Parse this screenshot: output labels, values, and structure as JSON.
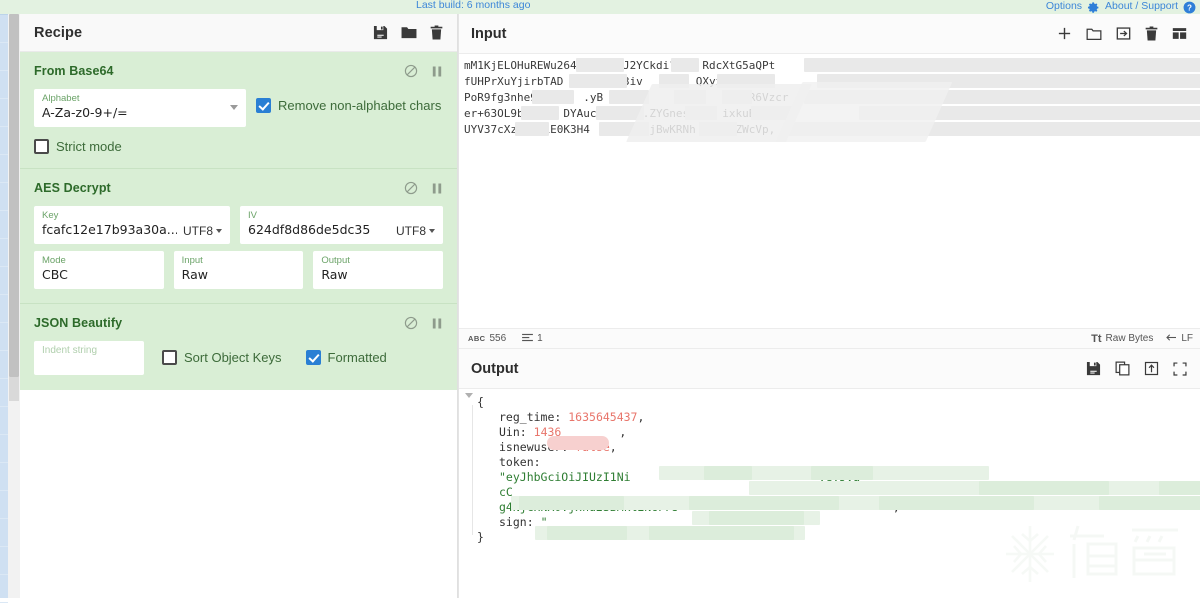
{
  "banner": {
    "build_text": "Last build: 6 months ago",
    "options_label": "Options",
    "about_label": "About / Support"
  },
  "recipe": {
    "title": "Recipe",
    "actions": [
      {
        "name": "save-recipe-icon",
        "label": "Save recipe"
      },
      {
        "name": "load-recipe-icon",
        "label": "Load recipe"
      },
      {
        "name": "clear-recipe-icon",
        "label": "Clear recipe"
      }
    ],
    "operations": [
      {
        "name": "From Base64",
        "args": {
          "alphabet_label": "Alphabet",
          "alphabet_value": "A-Za-z0-9+/=",
          "remove_non_alphabet_label": "Remove non-alphabet chars",
          "remove_non_alphabet_checked": true,
          "strict_mode_label": "Strict mode",
          "strict_mode_checked": false
        }
      },
      {
        "name": "AES Decrypt",
        "args": {
          "key_label": "Key",
          "key_value": "fcafc12e17b93a30a...",
          "key_encoding": "UTF8",
          "iv_label": "IV",
          "iv_value": "624df8d86de5dc35",
          "iv_encoding": "UTF8",
          "mode_label": "Mode",
          "mode_value": "CBC",
          "input_label": "Input",
          "input_value": "Raw",
          "output_label": "Output",
          "output_value": "Raw"
        }
      },
      {
        "name": "JSON Beautify",
        "args": {
          "indent_label": "Indent string",
          "indent_value": "",
          "sort_keys_label": "Sort Object Keys",
          "sort_keys_checked": false,
          "formatted_label": "Formatted",
          "formatted_checked": true
        }
      }
    ]
  },
  "input": {
    "title": "Input",
    "actions": [
      {
        "name": "add-input-tab-icon",
        "label": "Add a new input tab"
      },
      {
        "name": "open-folder-icon",
        "label": "Open folder as input"
      },
      {
        "name": "open-file-icon",
        "label": "Open file as input"
      },
      {
        "name": "clear-input-icon",
        "label": "Clear input and output"
      },
      {
        "name": "reset-pane-layout-icon",
        "label": "Reset pane layout"
      }
    ],
    "lines": [
      "mM1KjELOHuREWu264H      J2YCkdi?    RdcXtG5aQPt",
      "fUHPrXuYjirbTAD        n3iv        QXyxfs6aS7",
      "PoR9fg3nhe9(      .yB     Q?    4n.    PHc3R6Vzcr",
      "er+63OL9b\"     DYAuc       .ZYGnes     ixkuB+Kzp,",
      "UYV37cXz)   1E0K3H4      aoojBwKRNh    z2ZWcVp,"
    ],
    "status": {
      "length_icon": "abc",
      "length": "556",
      "lines_icon": "lines",
      "lines": "1",
      "font_icon": "Tt",
      "encoding": "Raw Bytes",
      "line_ending": "LF"
    }
  },
  "output": {
    "title": "Output",
    "actions": [
      {
        "name": "save-output-icon",
        "label": "Save output to file"
      },
      {
        "name": "copy-output-icon",
        "label": "Copy raw output to the clipboard"
      },
      {
        "name": "replace-input-icon",
        "label": "Replace input with output"
      },
      {
        "name": "maximise-output-icon",
        "label": "Maximise output pane"
      }
    ],
    "json": [
      {
        "indent": 0,
        "text": "{",
        "type": "punct"
      },
      {
        "indent": 1,
        "key": "reg_time",
        "value": "1635645437",
        "value_type": "num",
        "trail": ","
      },
      {
        "indent": 1,
        "key": "Uin",
        "value": "1436",
        "value_type": "num",
        "trail": ",",
        "redacted": true
      },
      {
        "indent": 1,
        "key": "isnewuser",
        "value": "false",
        "value_type": "bool",
        "trail": ","
      },
      {
        "indent": 1,
        "key": "token",
        "value": "",
        "value_type": "none",
        "trail": ""
      },
      {
        "indent": 1,
        "key": "",
        "value": "\"eyJhbGciOiJIUzI1Ni",
        "value_type": "str",
        "trail": ""
      },
      {
        "indent": 1,
        "key": "",
        "value": "cC",
        "value_type": "str",
        "trail": ""
      },
      {
        "indent": 1,
        "key": "",
        "value": "g4NjcxNX0.jxhu2SBMkl2N6PFJ'",
        "value_type": "str",
        "trail": "\","
      },
      {
        "indent": 1,
        "key": "sign",
        "value": "\"",
        "value_type": "str",
        "trail": ""
      },
      {
        "indent": 0,
        "text": "}",
        "type": "punct"
      }
    ],
    "token_fragment_2": ".eyJVa",
    "sign_close_quote": "\""
  },
  "watermark": {
    "text": "看雪"
  },
  "colors": {
    "recipe_bg": "#d9eed5",
    "op_title": "#2d6a2a",
    "accent_blue": "#2a7fd4",
    "link_blue": "#3c86d8",
    "string_green": "#2e7d32",
    "number_red": "#e8756b",
    "banner_bg": "#e3f2e1"
  }
}
